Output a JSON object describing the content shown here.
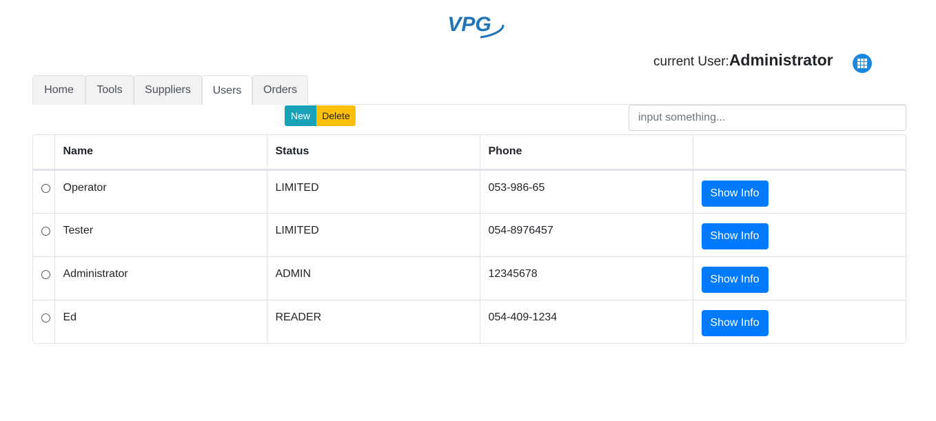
{
  "logo": {
    "text": "VPG",
    "color": "#1f73b7"
  },
  "header": {
    "current_user_label": "current User:",
    "current_user_name": "Administrator",
    "apps_icon": "grid-icon"
  },
  "tabs": [
    {
      "label": "Home",
      "active": false
    },
    {
      "label": "Tools",
      "active": false
    },
    {
      "label": "Suppliers",
      "active": false
    },
    {
      "label": "Users",
      "active": true
    },
    {
      "label": "Orders",
      "active": false
    }
  ],
  "toolbar": {
    "new_label": "New",
    "delete_label": "Delete",
    "search_placeholder": "input something..."
  },
  "table": {
    "columns": [
      "Name",
      "Status",
      "Phone"
    ],
    "action_label": "Show Info",
    "rows": [
      {
        "name": "Operator",
        "status": "LIMITED",
        "phone": "053-986-65"
      },
      {
        "name": "Tester",
        "status": "LIMITED",
        "phone": "054-8976457"
      },
      {
        "name": "Administrator",
        "status": "ADMIN",
        "phone": "12345678"
      },
      {
        "name": "Ed",
        "status": "READER",
        "phone": "054-409-1234"
      }
    ]
  },
  "colors": {
    "primary": "#007bff",
    "info": "#17a2b8",
    "warning": "#ffc107",
    "apps_button": "#1b88e0"
  }
}
